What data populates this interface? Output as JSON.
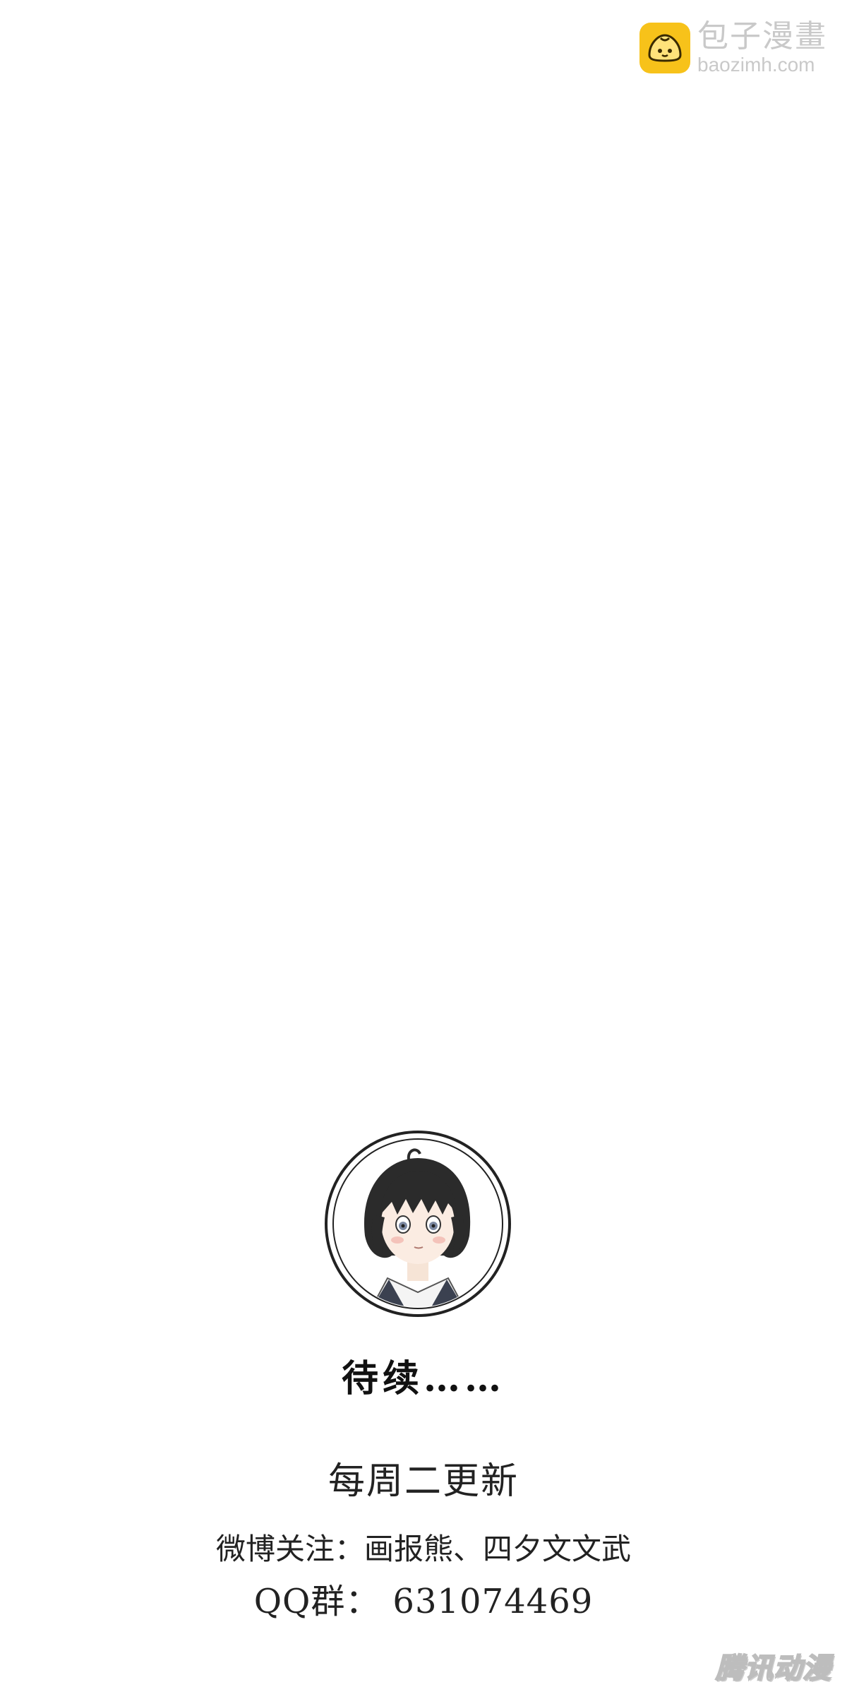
{
  "watermark": {
    "site_name": "包子漫畫",
    "site_url": "baozimh.com",
    "logo_icon": "steamed-bun-icon",
    "logo_color": "#f7c21a"
  },
  "avatar": {
    "icon": "author-avatar-girl-icon"
  },
  "footer": {
    "to_be_continued": "待续……",
    "schedule": "每周二更新",
    "weibo_line": "微博关注：画报熊、四夕文文武",
    "qq_label": "QQ群：",
    "qq_number": "631074469"
  },
  "publisher": {
    "mark": "腾讯动漫"
  }
}
